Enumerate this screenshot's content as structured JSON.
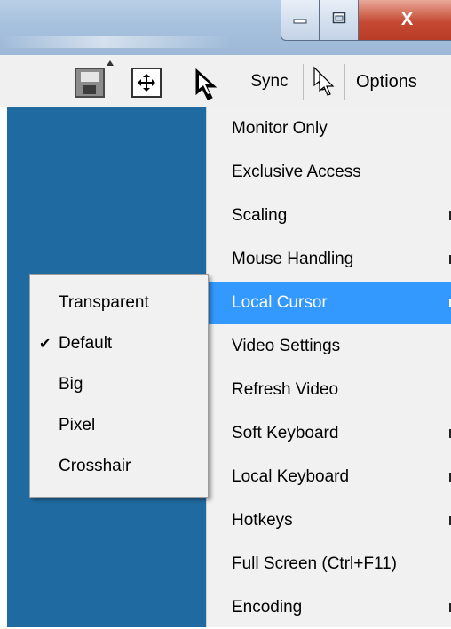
{
  "titlebar": {
    "minimize_icon": "minimize-icon",
    "maximize_icon": "maximize-icon",
    "close_label": "X"
  },
  "toolbar": {
    "save_icon": "save-icon",
    "fit_icon": "fit-screen-icon",
    "cursor_icon": "cursor-icon",
    "sync_label": "Sync",
    "dual_cursor_icon": "dual-cursor-icon",
    "options_label": "Options"
  },
  "menu": {
    "items": [
      {
        "label": "Monitor Only",
        "submenu": false
      },
      {
        "label": "Exclusive Access",
        "submenu": false
      },
      {
        "label": "Scaling",
        "submenu": true
      },
      {
        "label": "Mouse Handling",
        "submenu": true
      },
      {
        "label": "Local Cursor",
        "submenu": true,
        "active": true
      },
      {
        "label": "Video Settings",
        "submenu": false
      },
      {
        "label": "Refresh Video",
        "submenu": false
      },
      {
        "label": "Soft Keyboard",
        "submenu": true
      },
      {
        "label": "Local Keyboard",
        "submenu": true
      },
      {
        "label": "Hotkeys",
        "submenu": true
      },
      {
        "label": "Full Screen (Ctrl+F11)",
        "submenu": false
      },
      {
        "label": "Encoding",
        "submenu": true
      }
    ]
  },
  "submenu": {
    "check_glyph": "✔",
    "items": [
      {
        "label": "Transparent",
        "checked": false
      },
      {
        "label": "Default",
        "checked": true
      },
      {
        "label": "Big",
        "checked": false
      },
      {
        "label": "Pixel",
        "checked": false
      },
      {
        "label": "Crosshair",
        "checked": false
      }
    ]
  },
  "colors": {
    "highlight": "#3399ff",
    "remote_background": "#1f6ba1",
    "menu_background": "#f1f1f1"
  }
}
